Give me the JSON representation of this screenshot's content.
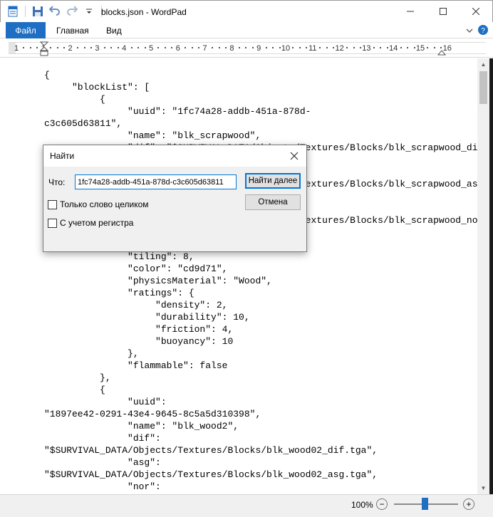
{
  "window": {
    "title": "blocks.json - WordPad"
  },
  "ribbon": {
    "file_tab": "Файл",
    "tabs": [
      "Главная",
      "Вид"
    ]
  },
  "ruler": {
    "numbers": [
      "1",
      "1",
      "2",
      "3",
      "4",
      "5",
      "6",
      "7",
      "8",
      "9",
      "10",
      "11",
      "12",
      "13",
      "14",
      "15",
      "16"
    ]
  },
  "document": {
    "lines": [
      "{",
      "     \"blockList\": [",
      "          {",
      "               \"uuid\": \"1fc74a28-addb-451a-878d-",
      "c3c605d63811\",",
      "               \"name\": \"blk_scrapwood\",",
      "               \"dif\": \"$SURVIVAL_DATA/Objects/Textures/Blocks/blk_scrapwood_dif.tga\"",
      "",
      "",
      "               \"asg\": \"$SURVIVAL_DATA/Objects/Textures/Blocks/blk_scrapwood_asg.tga\"",
      "",
      "",
      "               \"nor\": \"$SURVIVAL_DATA/Objects/Textures/Blocks/blk_scrapwood_nor.tga\"",
      "",
      "",
      "               \"tiling\": 8,",
      "               \"color\": \"cd9d71\",",
      "               \"physicsMaterial\": \"Wood\",",
      "               \"ratings\": {",
      "                    \"density\": 2,",
      "                    \"durability\": 10,",
      "                    \"friction\": 4,",
      "                    \"buoyancy\": 10",
      "               },",
      "               \"flammable\": false",
      "          },",
      "          {",
      "               \"uuid\":",
      "\"1897ee42-0291-43e4-9645-8c5a5d310398\",",
      "               \"name\": \"blk_wood2\",",
      "               \"dif\":",
      "\"$SURVIVAL_DATA/Objects/Textures/Blocks/blk_wood02_dif.tga\",",
      "               \"asg\":",
      "\"$SURVIVAL_DATA/Objects/Textures/Blocks/blk_wood02_asg.tga\",",
      "               \"nor\":"
    ]
  },
  "find_dialog": {
    "title": "Найти",
    "what_label": "Что:",
    "search_value": "1fc74a28-addb-451a-878d-c3c605d63811",
    "find_next_label": "Найти далее",
    "cancel_label": "Отмена",
    "whole_word_label": "Только слово целиком",
    "match_case_label": "С учетом регистра",
    "whole_word_checked": false,
    "match_case_checked": false
  },
  "statusbar": {
    "zoom_label": "100%",
    "zoom_level_percent": 100
  },
  "colors": {
    "accent": "#1e6fc4",
    "focus": "#0078d7"
  }
}
